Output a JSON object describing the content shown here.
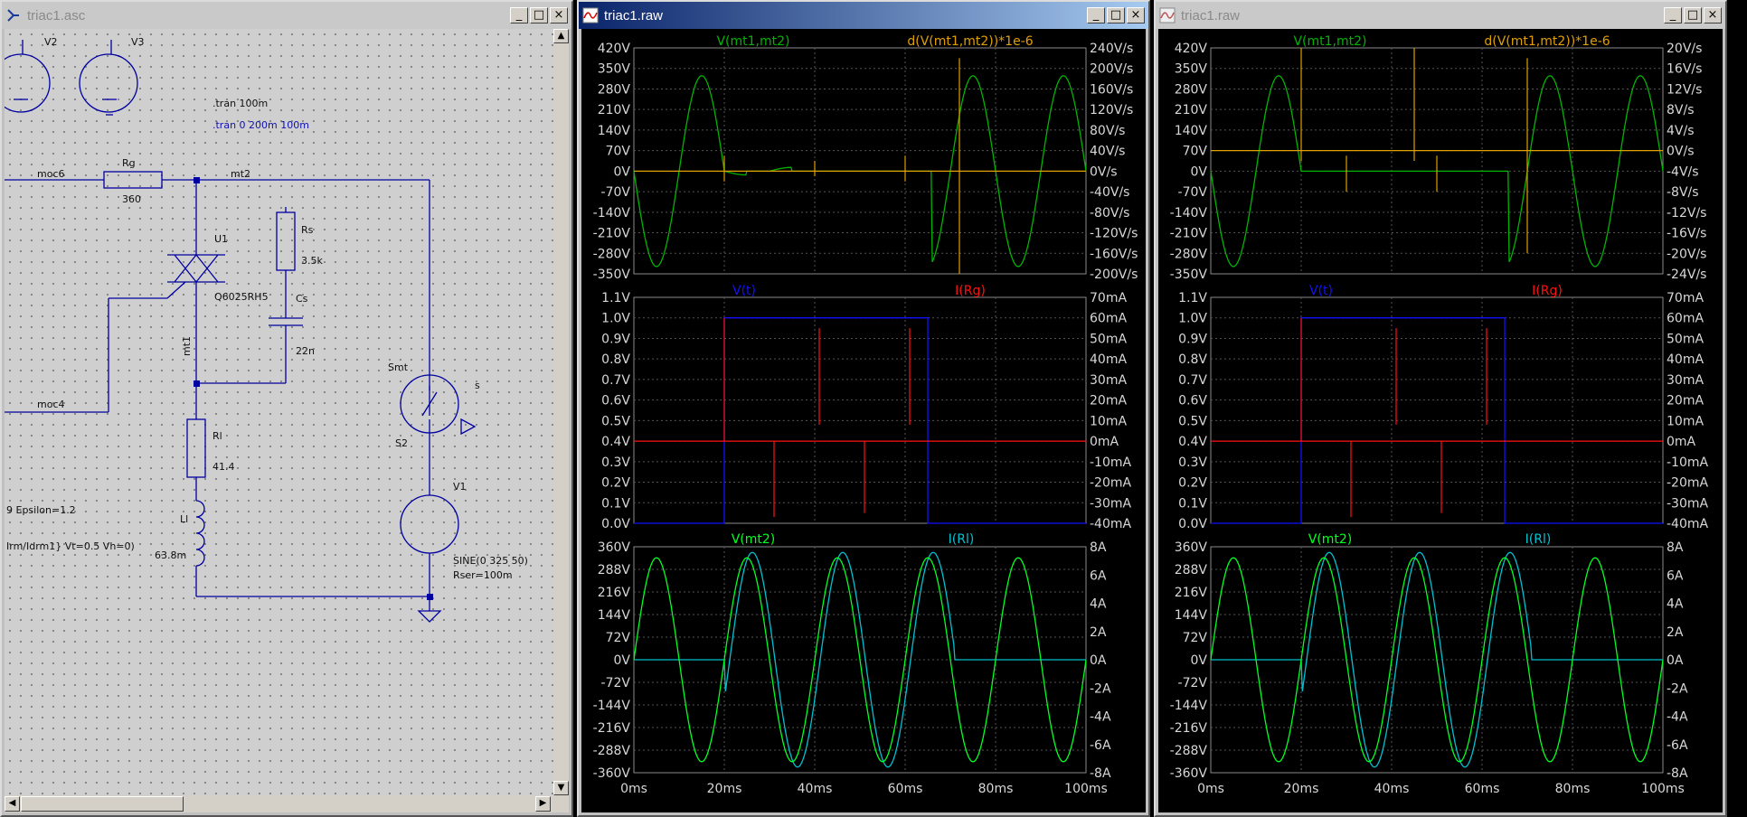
{
  "schematic_window": {
    "title": "triac1.asc",
    "buttons": {
      "minimize": "_",
      "maximize": "□",
      "close": "×"
    },
    "labels": {
      "v2": "V2",
      "v3": "V3",
      "tran1": ".tran 100m",
      "tran2": ".tran 0 200m 100m",
      "moc6": "moc6",
      "rg": "Rg",
      "rg_val": "360",
      "mt2": "mt2",
      "u1": "U1",
      "triac_model": "Q6025RH5",
      "rs": "Rs",
      "rs_val": "3.5k",
      "cs": "Cs",
      "cs_val": "22n",
      "mt1": "mt1",
      "moc4": "moc4",
      "smt": "Smt",
      "s_pin": "s",
      "s2": "S2",
      "rl": "Rl",
      "rl_val": "41.4",
      "ll": "Ll",
      "ll_val": "63.8m",
      "v1": "V1",
      "sine": "SINE(0 325 50)",
      "rser": "Rser=100m",
      "epsilon": "9 Epsilon=1.2",
      "irm": "Irm/Idrm1} Vt=0.5 Vh=0)"
    },
    "scroll_arrows": {
      "up": "▲",
      "down": "▼",
      "left": "◀",
      "right": "▶"
    }
  },
  "waveform_windows": [
    {
      "title": "triac1.raw",
      "active": true,
      "buttons": {
        "minimize": "_",
        "maximize": "□",
        "close": "×"
      }
    },
    {
      "title": "triac1.raw",
      "active": false,
      "buttons": {
        "minimize": "_",
        "maximize": "□",
        "close": "×"
      }
    }
  ],
  "colors": {
    "green_trace": "#00b400",
    "orange_trace": "#e0a000",
    "blue_trace": "#1010ff",
    "red_trace": "#ff1010",
    "bright_green_trace": "#00ff20",
    "cyan_trace": "#00c0d0",
    "schematic_wire": "#0000a0"
  },
  "chart_data": [
    {
      "type": "line",
      "panel": "top",
      "window": 1,
      "series": [
        {
          "name": "V(mt1,mt2)",
          "axis": "left"
        },
        {
          "name": "d(V(mt1,mt2))*1e-6",
          "axis": "right"
        }
      ],
      "left_ticks": [
        "420V",
        "350V",
        "280V",
        "210V",
        "140V",
        "70V",
        "0V",
        "-70V",
        "-140V",
        "-210V",
        "-280V",
        "-350V"
      ],
      "right_ticks": [
        "240V/s",
        "200V/s",
        "160V/s",
        "120V/s",
        "80V/s",
        "40V/s",
        "0V/s",
        "-40V/s",
        "-80V/s",
        "-120V/s",
        "-160V/s",
        "-200V/s"
      ],
      "ylim_left": [
        -350,
        420
      ],
      "ylim_right": [
        -200,
        240
      ],
      "grid": true
    },
    {
      "type": "line",
      "panel": "middle",
      "window": 1,
      "series": [
        {
          "name": "V(t)",
          "axis": "left",
          "x": [
            0,
            20,
            20,
            65,
            65,
            100
          ],
          "y": [
            0,
            0,
            1,
            1,
            0,
            0
          ]
        },
        {
          "name": "I(Rg)",
          "axis": "right"
        }
      ],
      "left_ticks": [
        "1.1V",
        "1.0V",
        "0.9V",
        "0.8V",
        "0.7V",
        "0.6V",
        "0.5V",
        "0.4V",
        "0.3V",
        "0.2V",
        "0.1V",
        "0.0V"
      ],
      "right_ticks": [
        "70mA",
        "60mA",
        "50mA",
        "40mA",
        "30mA",
        "20mA",
        "10mA",
        "0mA",
        "-10mA",
        "-20mA",
        "-30mA",
        "-40mA"
      ],
      "ylim_left": [
        0,
        1.1
      ],
      "ylim_right": [
        -40,
        70
      ],
      "grid": true
    },
    {
      "type": "line",
      "panel": "bottom",
      "window": 1,
      "series": [
        {
          "name": "V(mt2)",
          "axis": "left",
          "amplitude": 325,
          "frequency_hz": 50
        },
        {
          "name": "I(Rl)",
          "axis": "right"
        }
      ],
      "left_ticks": [
        "360V",
        "288V",
        "216V",
        "144V",
        "72V",
        "0V",
        "-72V",
        "-144V",
        "-216V",
        "-288V",
        "-360V"
      ],
      "right_ticks": [
        "8A",
        "6A",
        "4A",
        "2A",
        "0A",
        "-2A",
        "-4A",
        "-6A",
        "-8A"
      ],
      "x_ticks": [
        "0ms",
        "20ms",
        "40ms",
        "60ms",
        "80ms",
        "100ms"
      ],
      "ylim_left": [
        -360,
        360
      ],
      "ylim_right": [
        -8,
        8
      ],
      "xlim": [
        0,
        100
      ],
      "grid": true
    },
    {
      "type": "line",
      "panel": "top",
      "window": 2,
      "series": [
        {
          "name": "V(mt1,mt2)",
          "axis": "left"
        },
        {
          "name": "d(V(mt1,mt2))*1e-6",
          "axis": "right"
        }
      ],
      "left_ticks": [
        "420V",
        "350V",
        "280V",
        "210V",
        "140V",
        "70V",
        "0V",
        "-70V",
        "-140V",
        "-210V",
        "-280V",
        "-350V"
      ],
      "right_ticks": [
        "20V/s",
        "16V/s",
        "12V/s",
        "8V/s",
        "4V/s",
        "0V/s",
        "-4V/s",
        "-8V/s",
        "-12V/s",
        "-16V/s",
        "-20V/s",
        "-24V/s"
      ],
      "ylim_left": [
        -350,
        420
      ],
      "ylim_right": [
        -24,
        20
      ],
      "grid": true
    },
    {
      "type": "line",
      "panel": "middle",
      "window": 2,
      "series": [
        {
          "name": "V(t)",
          "axis": "left",
          "x": [
            0,
            20,
            20,
            65,
            65,
            100
          ],
          "y": [
            0,
            0,
            1,
            1,
            0,
            0
          ]
        },
        {
          "name": "I(Rg)",
          "axis": "right"
        }
      ],
      "left_ticks": [
        "1.1V",
        "1.0V",
        "0.9V",
        "0.8V",
        "0.7V",
        "0.6V",
        "0.5V",
        "0.4V",
        "0.3V",
        "0.2V",
        "0.1V",
        "0.0V"
      ],
      "right_ticks": [
        "70mA",
        "60mA",
        "50mA",
        "40mA",
        "30mA",
        "20mA",
        "10mA",
        "0mA",
        "-10mA",
        "-20mA",
        "-30mA",
        "-40mA"
      ],
      "ylim_left": [
        0,
        1.1
      ],
      "ylim_right": [
        -40,
        70
      ],
      "grid": true
    },
    {
      "type": "line",
      "panel": "bottom",
      "window": 2,
      "series": [
        {
          "name": "V(mt2)",
          "axis": "left",
          "amplitude": 325,
          "frequency_hz": 50
        },
        {
          "name": "I(Rl)",
          "axis": "right"
        }
      ],
      "left_ticks": [
        "360V",
        "288V",
        "216V",
        "144V",
        "72V",
        "0V",
        "-72V",
        "-144V",
        "-216V",
        "-288V",
        "-360V"
      ],
      "right_ticks": [
        "8A",
        "6A",
        "4A",
        "2A",
        "0A",
        "-2A",
        "-4A",
        "-6A",
        "-8A"
      ],
      "x_ticks": [
        "0ms",
        "20ms",
        "40ms",
        "60ms",
        "80ms",
        "100ms"
      ],
      "ylim_left": [
        -360,
        360
      ],
      "ylim_right": [
        -8,
        8
      ],
      "xlim": [
        0,
        100
      ],
      "grid": true
    }
  ]
}
